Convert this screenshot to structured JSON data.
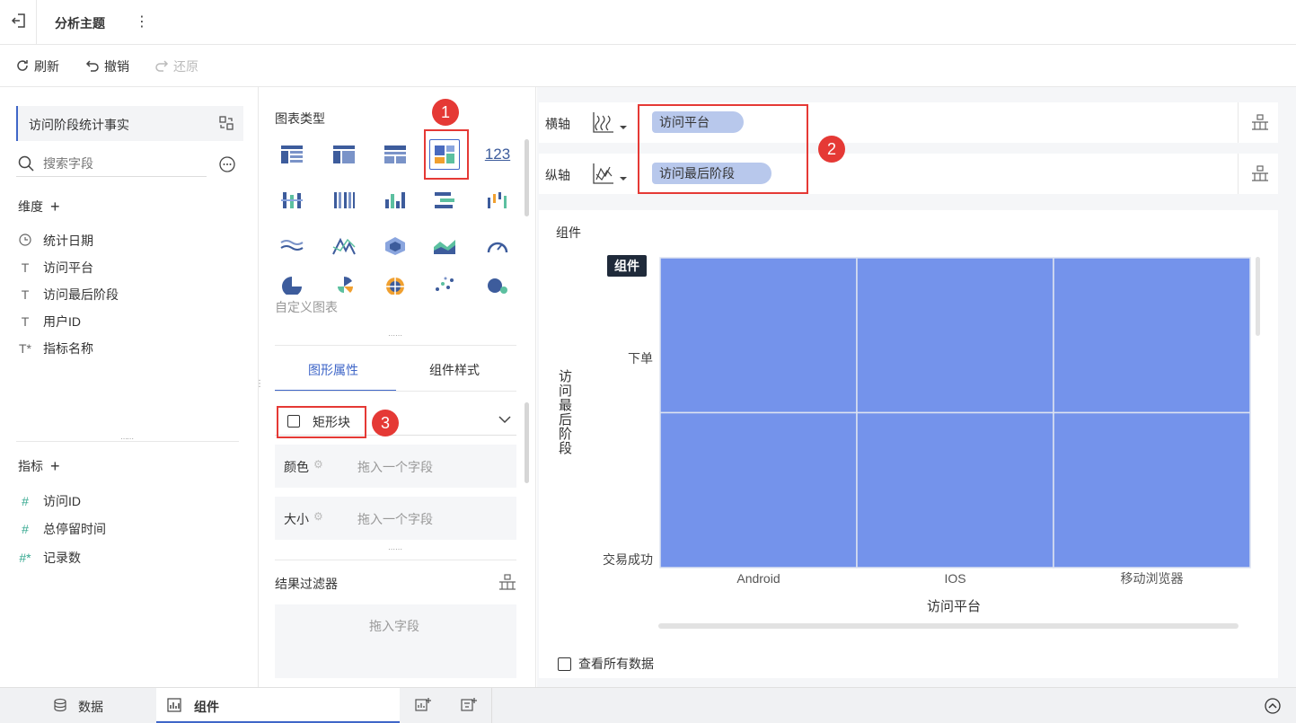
{
  "topbar": {
    "title": "分析主题",
    "more_icon": "more-vert-icon"
  },
  "toolbar": {
    "refresh": "刷新",
    "undo": "撤销",
    "redo": "还原"
  },
  "left": {
    "dataset": "访问阶段统计事实",
    "search_placeholder": "搜索字段",
    "dimensions_label": "维度",
    "dimensions": [
      "统计日期",
      "访问平台",
      "访问最后阶段",
      "用户ID",
      "指标名称"
    ],
    "measures_label": "指标",
    "measures": [
      "访问ID",
      "总停留时间",
      "记录数"
    ]
  },
  "mid": {
    "chart_type_label": "图表类型",
    "custom_chart": "自定义图表",
    "tabs": [
      "图形属性",
      "组件样式"
    ],
    "mark_type": "矩形块",
    "props": [
      {
        "label": "颜色",
        "placeholder": "拖入一个字段"
      },
      {
        "label": "大小",
        "placeholder": "拖入一个字段"
      }
    ],
    "filter_label": "结果过滤器",
    "filter_placeholder": "拖入字段"
  },
  "axes": {
    "x_label": "横轴",
    "x_field": "访问平台",
    "y_label": "纵轴",
    "y_field": "访问最后阶段"
  },
  "badges": [
    "1",
    "2",
    "3"
  ],
  "chart_data": {
    "type": "heatmap",
    "title": "组件",
    "tooltip": "组件",
    "categories": [
      "Android",
      "IOS",
      "移动浏览器"
    ],
    "y_categories": [
      "下单",
      "交易成功"
    ],
    "xlabel": "访问平台",
    "ylabel": "访问最后阶段",
    "color": "#7493eb"
  },
  "chart_footer": {
    "view_all": "查看所有数据"
  },
  "bottom": {
    "tabs": [
      "数据",
      "组件"
    ]
  }
}
